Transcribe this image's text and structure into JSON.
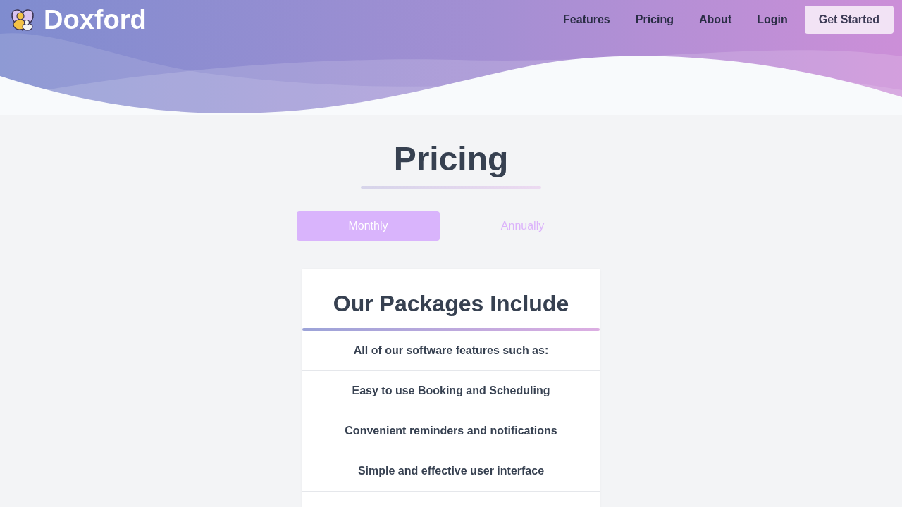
{
  "brand": {
    "name": "Doxford"
  },
  "nav": {
    "links": [
      {
        "label": "Features"
      },
      {
        "label": "Pricing"
      },
      {
        "label": "About"
      },
      {
        "label": "Login"
      }
    ],
    "cta": "Get Started"
  },
  "page": {
    "title": "Pricing"
  },
  "billing_tabs": [
    {
      "label": "Monthly",
      "selected": true
    },
    {
      "label": "Annually",
      "selected": false
    }
  ],
  "packages": {
    "title": "Our Packages Include",
    "features": [
      "All of our software features such as:",
      "Easy to use Booking and Scheduling",
      "Convenient reminders and notifications",
      "Simple and effective user interface"
    ]
  }
}
